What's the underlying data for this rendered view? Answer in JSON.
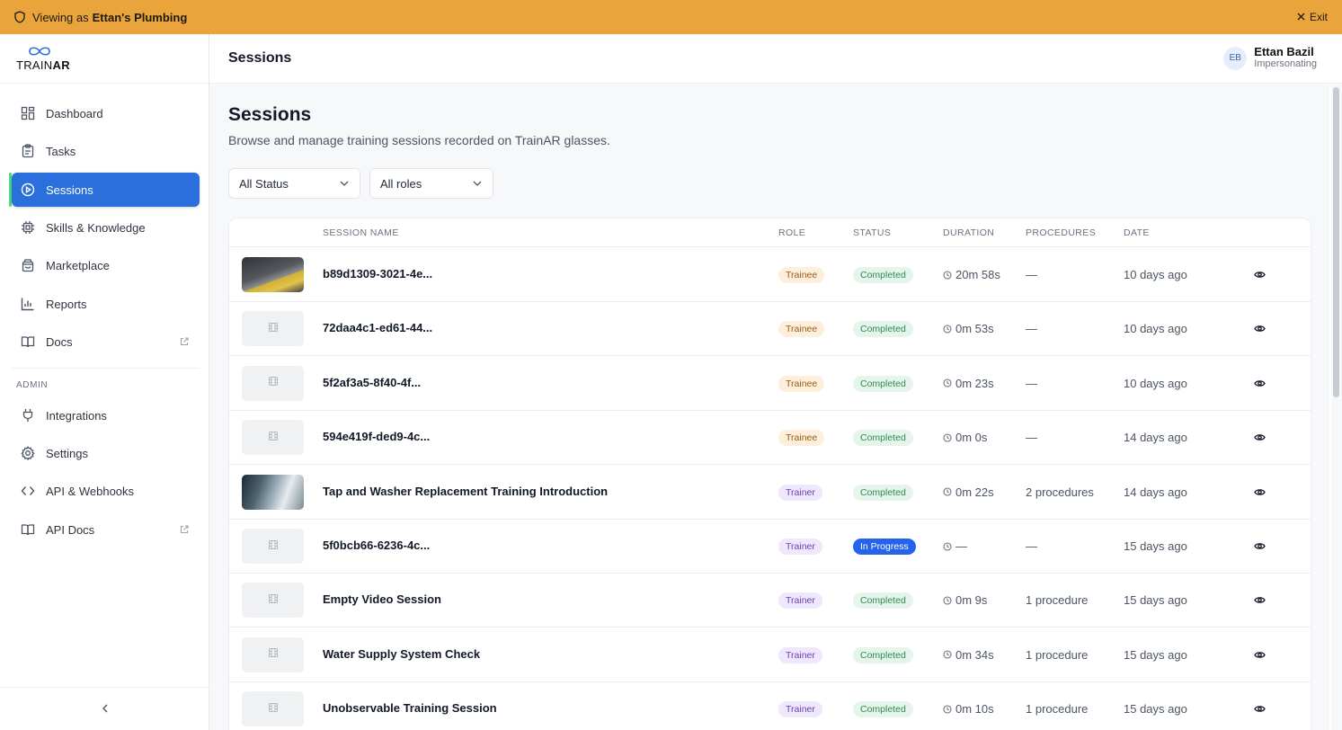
{
  "banner": {
    "prefix": "Viewing as",
    "org": "Ettan's Plumbing",
    "exit_label": "Exit"
  },
  "brand": {
    "name_light": "TRAIN",
    "name_bold": "AR"
  },
  "sidebar": {
    "items": [
      {
        "label": "Dashboard",
        "icon": "dashboard-icon"
      },
      {
        "label": "Tasks",
        "icon": "clipboard-icon"
      },
      {
        "label": "Sessions",
        "icon": "play-circle-icon",
        "active": true
      },
      {
        "label": "Skills & Knowledge",
        "icon": "chip-icon"
      },
      {
        "label": "Marketplace",
        "icon": "bag-icon"
      },
      {
        "label": "Reports",
        "icon": "bar-chart-icon"
      },
      {
        "label": "Docs",
        "icon": "book-icon",
        "external": true
      }
    ],
    "admin_label": "ADMIN",
    "admin_items": [
      {
        "label": "Integrations",
        "icon": "plug-icon"
      },
      {
        "label": "Settings",
        "icon": "gear-icon"
      },
      {
        "label": "API & Webhooks",
        "icon": "code-icon"
      },
      {
        "label": "API Docs",
        "icon": "book-icon",
        "external": true
      }
    ]
  },
  "header": {
    "title": "Sessions"
  },
  "user": {
    "initials": "EB",
    "name": "Ettan Bazil",
    "status": "Impersonating"
  },
  "page": {
    "title": "Sessions",
    "description": "Browse and manage training sessions recorded on TrainAR glasses."
  },
  "filters": {
    "status": "All Status",
    "roles": "All roles"
  },
  "table": {
    "columns": [
      "SESSION NAME",
      "ROLE",
      "STATUS",
      "DURATION",
      "PROCEDURES",
      "DATE"
    ],
    "rows": [
      {
        "name": "b89d1309-3021-4e...",
        "role": "Trainee",
        "status": "Completed",
        "duration": "20m 58s",
        "procedures": "—",
        "date": "10 days ago",
        "thumb": "photo1"
      },
      {
        "name": "72daa4c1-ed61-44...",
        "role": "Trainee",
        "status": "Completed",
        "duration": "0m 53s",
        "procedures": "—",
        "date": "10 days ago",
        "thumb": "placeholder"
      },
      {
        "name": "5f2af3a5-8f40-4f...",
        "role": "Trainee",
        "status": "Completed",
        "duration": "0m 23s",
        "procedures": "—",
        "date": "10 days ago",
        "thumb": "placeholder"
      },
      {
        "name": "594e419f-ded9-4c...",
        "role": "Trainee",
        "status": "Completed",
        "duration": "0m 0s",
        "procedures": "—",
        "date": "14 days ago",
        "thumb": "placeholder"
      },
      {
        "name": "Tap and Washer Replacement Training Introduction",
        "role": "Trainer",
        "status": "Completed",
        "duration": "0m 22s",
        "procedures": "2 procedures",
        "date": "14 days ago",
        "thumb": "photo2"
      },
      {
        "name": "5f0bcb66-6236-4c...",
        "role": "Trainer",
        "status": "In Progress",
        "duration": "—",
        "procedures": "—",
        "date": "15 days ago",
        "thumb": "placeholder"
      },
      {
        "name": "Empty Video Session",
        "role": "Trainer",
        "status": "Completed",
        "duration": "0m 9s",
        "procedures": "1 procedure",
        "date": "15 days ago",
        "thumb": "placeholder"
      },
      {
        "name": "Water Supply System Check",
        "role": "Trainer",
        "status": "Completed",
        "duration": "0m 34s",
        "procedures": "1 procedure",
        "date": "15 days ago",
        "thumb": "placeholder"
      },
      {
        "name": "Unobservable Training Session",
        "role": "Trainer",
        "status": "Completed",
        "duration": "0m 10s",
        "procedures": "1 procedure",
        "date": "15 days ago",
        "thumb": "placeholder"
      }
    ]
  },
  "colors": {
    "banner": "#e9a43c",
    "accent": "#2a6fdb",
    "active_marker": "#4ade80"
  }
}
